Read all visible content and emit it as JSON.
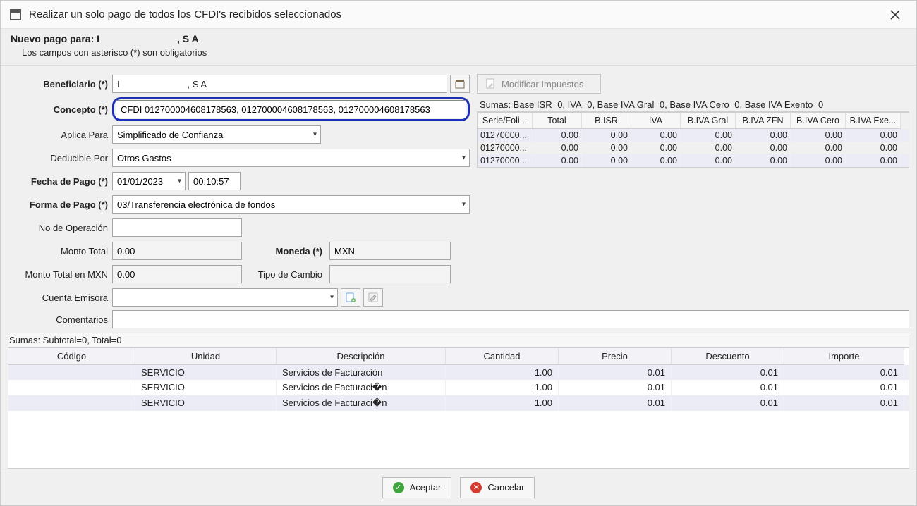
{
  "window": {
    "title": "Realizar un solo pago de todos los CFDI's recibidos seleccionados"
  },
  "subheader": {
    "line1_prefix": "Nuevo pago para: I",
    "line1_suffix": ", S A",
    "line2": "Los campos con asterisco (*) son obligatorios"
  },
  "labels": {
    "beneficiario": "Beneficiario (*)",
    "concepto": "Concepto (*)",
    "aplica_para": "Aplica Para",
    "deducible_por": "Deducible Por",
    "fecha_pago": "Fecha de Pago (*)",
    "forma_pago": "Forma de Pago (*)",
    "no_operacion": "No de Operación",
    "monto_total": "Monto Total",
    "moneda": "Moneda (*)",
    "monto_total_mxn": "Monto Total en MXN",
    "tipo_cambio": "Tipo de Cambio",
    "cuenta_emisora": "Cuenta Emisora",
    "comentarios": "Comentarios"
  },
  "fields": {
    "beneficiario_prefix": "I",
    "beneficiario_suffix": ", S A",
    "concepto": "CFDI 012700004608178563, 012700004608178563, 012700004608178563",
    "aplica_para": "Simplificado de Confianza",
    "deducible_por": "Otros Gastos",
    "fecha_pago": "01/01/2023",
    "hora_pago": "00:10:57",
    "forma_pago": "03/Transferencia electrónica de fondos",
    "no_operacion": "",
    "monto_total": "0.00",
    "moneda": "MXN",
    "monto_total_mxn": "0.00",
    "tipo_cambio": "",
    "cuenta_emisora": "",
    "comentarios": ""
  },
  "mod_impuestos_btn": "Modificar Impuestos",
  "tax_sums": "Sumas:  Base ISR=0, IVA=0, Base IVA Gral=0, Base IVA Cero=0, Base IVA Exento=0",
  "tax_headers": [
    "Serie/Foli...",
    "Total",
    "B.ISR",
    "IVA",
    "B.IVA Gral",
    "B.IVA ZFN",
    "B.IVA Cero",
    "B.IVA Exe..."
  ],
  "tax_rows": [
    {
      "serie": "01270000...",
      "total": "0.00",
      "bisr": "0.00",
      "iva": "0.00",
      "bgral": "0.00",
      "bzfn": "0.00",
      "bcero": "0.00",
      "bexe": "0.00"
    },
    {
      "serie": "01270000...",
      "total": "0.00",
      "bisr": "0.00",
      "iva": "0.00",
      "bgral": "0.00",
      "bzfn": "0.00",
      "bcero": "0.00",
      "bexe": "0.00"
    },
    {
      "serie": "01270000...",
      "total": "0.00",
      "bisr": "0.00",
      "iva": "0.00",
      "bgral": "0.00",
      "bzfn": "0.00",
      "bcero": "0.00",
      "bexe": "0.00"
    }
  ],
  "detail_sums": "Sumas:  Subtotal=0, Total=0",
  "detail_headers": [
    "Código",
    "Unidad",
    "Descripción",
    "Cantidad",
    "Precio",
    "Descuento",
    "Importe"
  ],
  "detail_rows": [
    {
      "codigo": "",
      "unidad": "SERVICIO",
      "desc": "Servicios de Facturación",
      "cant": "1.00",
      "precio": "0.01",
      "desc2": "0.01",
      "importe": "0.01"
    },
    {
      "codigo": "",
      "unidad": "SERVICIO",
      "desc": "Servicios de Facturaci�n",
      "cant": "1.00",
      "precio": "0.01",
      "desc2": "0.01",
      "importe": "0.01"
    },
    {
      "codigo": "",
      "unidad": "SERVICIO",
      "desc": "Servicios de Facturaci�n",
      "cant": "1.00",
      "precio": "0.01",
      "desc2": "0.01",
      "importe": "0.01"
    }
  ],
  "buttons": {
    "aceptar": "Aceptar",
    "cancelar": "Cancelar"
  }
}
